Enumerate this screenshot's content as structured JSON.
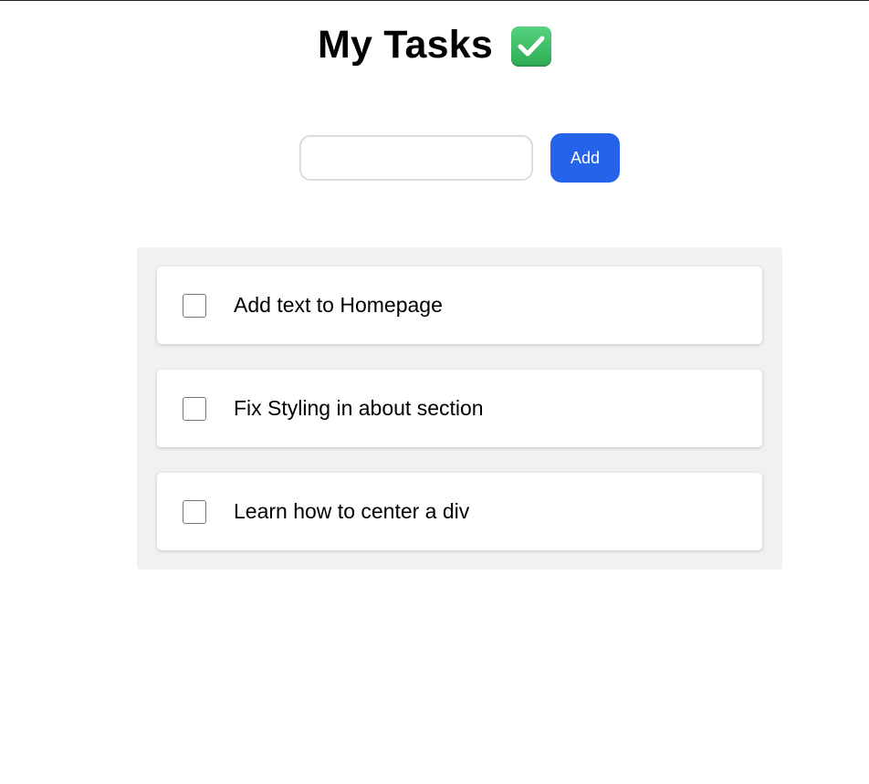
{
  "header": {
    "title": "My Tasks",
    "title_icon": "white-heavy-check-mark-emoji"
  },
  "new_task": {
    "value": "",
    "placeholder": "",
    "add_label": "Add"
  },
  "tasks": [
    {
      "label": "Add text to Homepage",
      "checked": false
    },
    {
      "label": "Fix Styling in about section",
      "checked": false
    },
    {
      "label": "Learn how to center a div",
      "checked": false
    }
  ],
  "colors": {
    "accent": "#2563eb",
    "panel_bg": "#f1f1f1",
    "check_emoji_green": "#3fbf67"
  }
}
